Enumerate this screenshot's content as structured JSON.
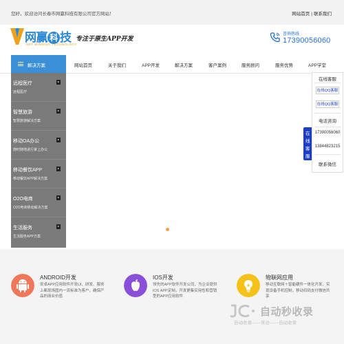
{
  "topbar": {
    "welcome": "您好，欢迎访问长春市网赢科技有限公司官方网站！",
    "link_home": "网站首页",
    "link_sep": "|",
    "link_contact": "联系我们"
  },
  "header": {
    "logo_text_a": "网赢",
    "logo_text_b": "科",
    "logo_text_c": "技",
    "logo_sub": "NET WINNING TECHNOLOGY",
    "slogan": "专注于原生APP开发",
    "hotline_label": "咨询热线",
    "hotline_number": "17390056060"
  },
  "side": {
    "title": "解决方案",
    "items": [
      {
        "title": "远程医疗",
        "sub": "远程医疗"
      },
      {
        "title": "智慧旅游",
        "sub": "智慧旅游解决方案"
      },
      {
        "title": "移动OA办公",
        "sub": "随时随地进行掌上办公"
      },
      {
        "title": "移动餐饮APP",
        "sub": "移动餐饮APP解决方案"
      },
      {
        "title": "O2O电商",
        "sub": "O2O电商移动解决方案"
      },
      {
        "title": "生活服务",
        "sub": "生活服务APP方案"
      }
    ]
  },
  "nav": {
    "items": [
      "网站首页",
      "关于我们",
      "APP开发",
      "解决方案",
      "客户案例",
      "服务顾问",
      "服务优势",
      "APP学堂"
    ]
  },
  "float": {
    "tab": [
      "在",
      "线",
      "客",
      "服"
    ],
    "title": "在线客服",
    "qq1": "在线QQ客服",
    "qq2": "在线QQ客服",
    "consult": "电话咨询",
    "phone1": "17390056060",
    "phone2": "13844823215",
    "wechat": "联系微信"
  },
  "features": [
    {
      "icon": "android-icon",
      "color": "#f0785a",
      "title": "ANDROID开发",
      "desc": "安卓APP应用软件开发UI、研发、服务上都现场国内一流标准为客户，确保产品的商业价值"
    },
    {
      "icon": "apple-icon",
      "color": "#8a4fd8",
      "title": "IOS开发",
      "desc": "领先的APP软件开发公司，为企业提供IOS APP定制，开发更集实用性和营销型的APP应用软件"
    },
    {
      "icon": "lightbulb-icon",
      "color": "#f5c21a",
      "title": "物联网应用",
      "desc": "移动互联网＋智能硬件一体化开发，实现设备手机控制，移动扫码支付微信共享"
    }
  ],
  "watermark": {
    "big": "自动秒收录",
    "small": "自动收录——来访——自动收录"
  },
  "colors": {
    "accent": "#3a8fd6",
    "hotline": "#1f6fd1",
    "side_bg": "#7a7a7a",
    "float_tab": "#1a3ec7"
  }
}
